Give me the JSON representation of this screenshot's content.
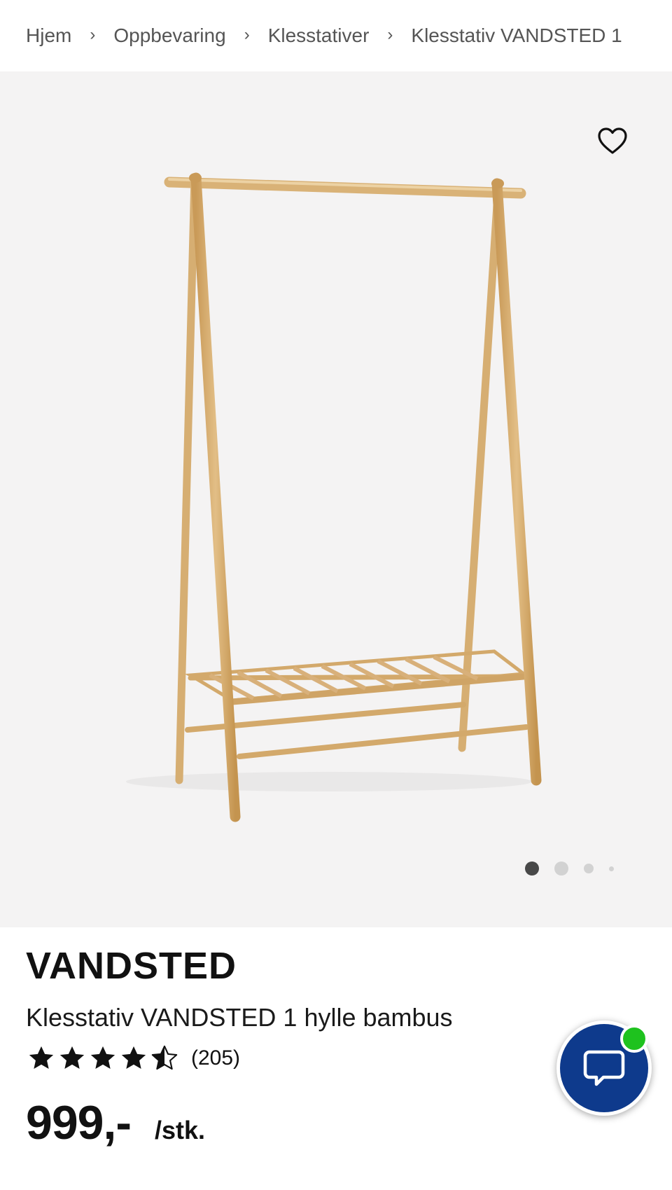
{
  "breadcrumb": {
    "items": [
      "Hjem",
      "Oppbevaring",
      "Klesstativer",
      "Klesstativ VANDSTED 1"
    ],
    "separator": "›"
  },
  "gallery": {
    "favorite_icon": "heart-outline-icon",
    "image_count": 4,
    "active_index": 0,
    "background": "#f4f3f3"
  },
  "product": {
    "brand": "VANDSTED",
    "name": "Klesstativ VANDSTED 1 hylle bambus",
    "rating": 4.5,
    "rating_max": 5,
    "review_count": "(205)",
    "price": "999,-",
    "unit": "/stk."
  },
  "chat": {
    "icon": "chat-bubble-icon",
    "status": "online",
    "button_color": "#0e3a8c",
    "status_color": "#1ec21e"
  }
}
